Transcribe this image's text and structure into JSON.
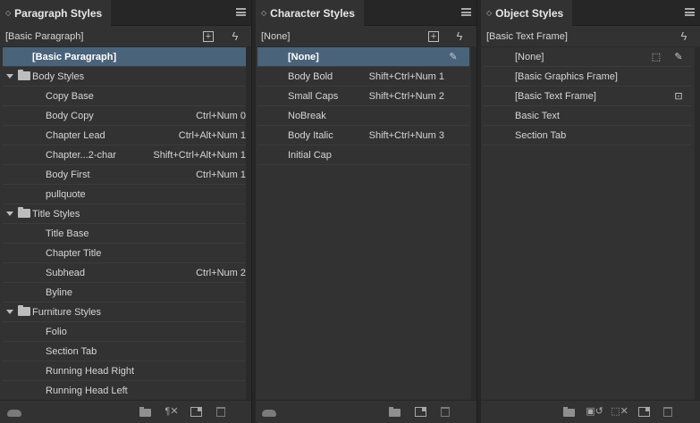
{
  "paragraph": {
    "tab": "Paragraph Styles",
    "current": "[Basic Paragraph]",
    "rows": [
      {
        "label": "[Basic Paragraph]",
        "shortcut": "",
        "type": "style",
        "indent": 1,
        "selected": true
      },
      {
        "label": "Body Styles",
        "shortcut": "",
        "type": "group",
        "indent": 0,
        "selected": false
      },
      {
        "label": "Copy Base",
        "shortcut": "",
        "type": "style",
        "indent": 2,
        "selected": false
      },
      {
        "label": "Body Copy",
        "shortcut": "Ctrl+Num 0",
        "type": "style",
        "indent": 2,
        "selected": false
      },
      {
        "label": "Chapter Lead",
        "shortcut": "Ctrl+Alt+Num 1",
        "type": "style",
        "indent": 2,
        "selected": false
      },
      {
        "label": "Chapter...2-char",
        "shortcut": "Shift+Ctrl+Alt+Num 1",
        "type": "style",
        "indent": 2,
        "selected": false
      },
      {
        "label": "Body First",
        "shortcut": "Ctrl+Num 1",
        "type": "style",
        "indent": 2,
        "selected": false
      },
      {
        "label": "pullquote",
        "shortcut": "",
        "type": "style",
        "indent": 2,
        "selected": false
      },
      {
        "label": "Title Styles",
        "shortcut": "",
        "type": "group",
        "indent": 0,
        "selected": false
      },
      {
        "label": "Title Base",
        "shortcut": "",
        "type": "style",
        "indent": 2,
        "selected": false
      },
      {
        "label": "Chapter Title",
        "shortcut": "",
        "type": "style",
        "indent": 2,
        "selected": false
      },
      {
        "label": "Subhead",
        "shortcut": "Ctrl+Num 2",
        "type": "style",
        "indent": 2,
        "selected": false
      },
      {
        "label": "Byline",
        "shortcut": "",
        "type": "style",
        "indent": 2,
        "selected": false
      },
      {
        "label": "Furniture Styles",
        "shortcut": "",
        "type": "group",
        "indent": 0,
        "selected": false
      },
      {
        "label": "Folio",
        "shortcut": "",
        "type": "style",
        "indent": 2,
        "selected": false
      },
      {
        "label": "Section Tab",
        "shortcut": "",
        "type": "style",
        "indent": 2,
        "selected": false
      },
      {
        "label": "Running Head Right",
        "shortcut": "",
        "type": "style",
        "indent": 2,
        "selected": false
      },
      {
        "label": "Running Head Left",
        "shortcut": "",
        "type": "style",
        "indent": 2,
        "selected": false
      }
    ]
  },
  "character": {
    "tab": "Character Styles",
    "current": "[None]",
    "rows": [
      {
        "label": "[None]",
        "shortcut": "",
        "selected": true
      },
      {
        "label": "Body Bold",
        "shortcut": "Shift+Ctrl+Num 1",
        "selected": false
      },
      {
        "label": "Small Caps",
        "shortcut": "Shift+Ctrl+Num 2",
        "selected": false
      },
      {
        "label": "NoBreak",
        "shortcut": "",
        "selected": false
      },
      {
        "label": "Body Italic",
        "shortcut": "Shift+Ctrl+Num 3",
        "selected": false
      },
      {
        "label": "Initial Cap",
        "shortcut": "",
        "selected": false
      }
    ]
  },
  "object": {
    "tab": "Object Styles",
    "current": "[Basic Text Frame]",
    "rows": [
      {
        "label": "[None]",
        "icons": [
          "frame-none-icon",
          "lock-icon"
        ]
      },
      {
        "label": "[Basic Graphics Frame]",
        "icons": []
      },
      {
        "label": "[Basic Text Frame]",
        "icons": [
          "text-frame-icon"
        ]
      },
      {
        "label": "Basic Text",
        "icons": []
      },
      {
        "label": "Section Tab",
        "icons": []
      }
    ]
  },
  "colors": {
    "panel_bg": "#323232",
    "selected_row": "#49637b",
    "text": "#d6d6d6"
  }
}
